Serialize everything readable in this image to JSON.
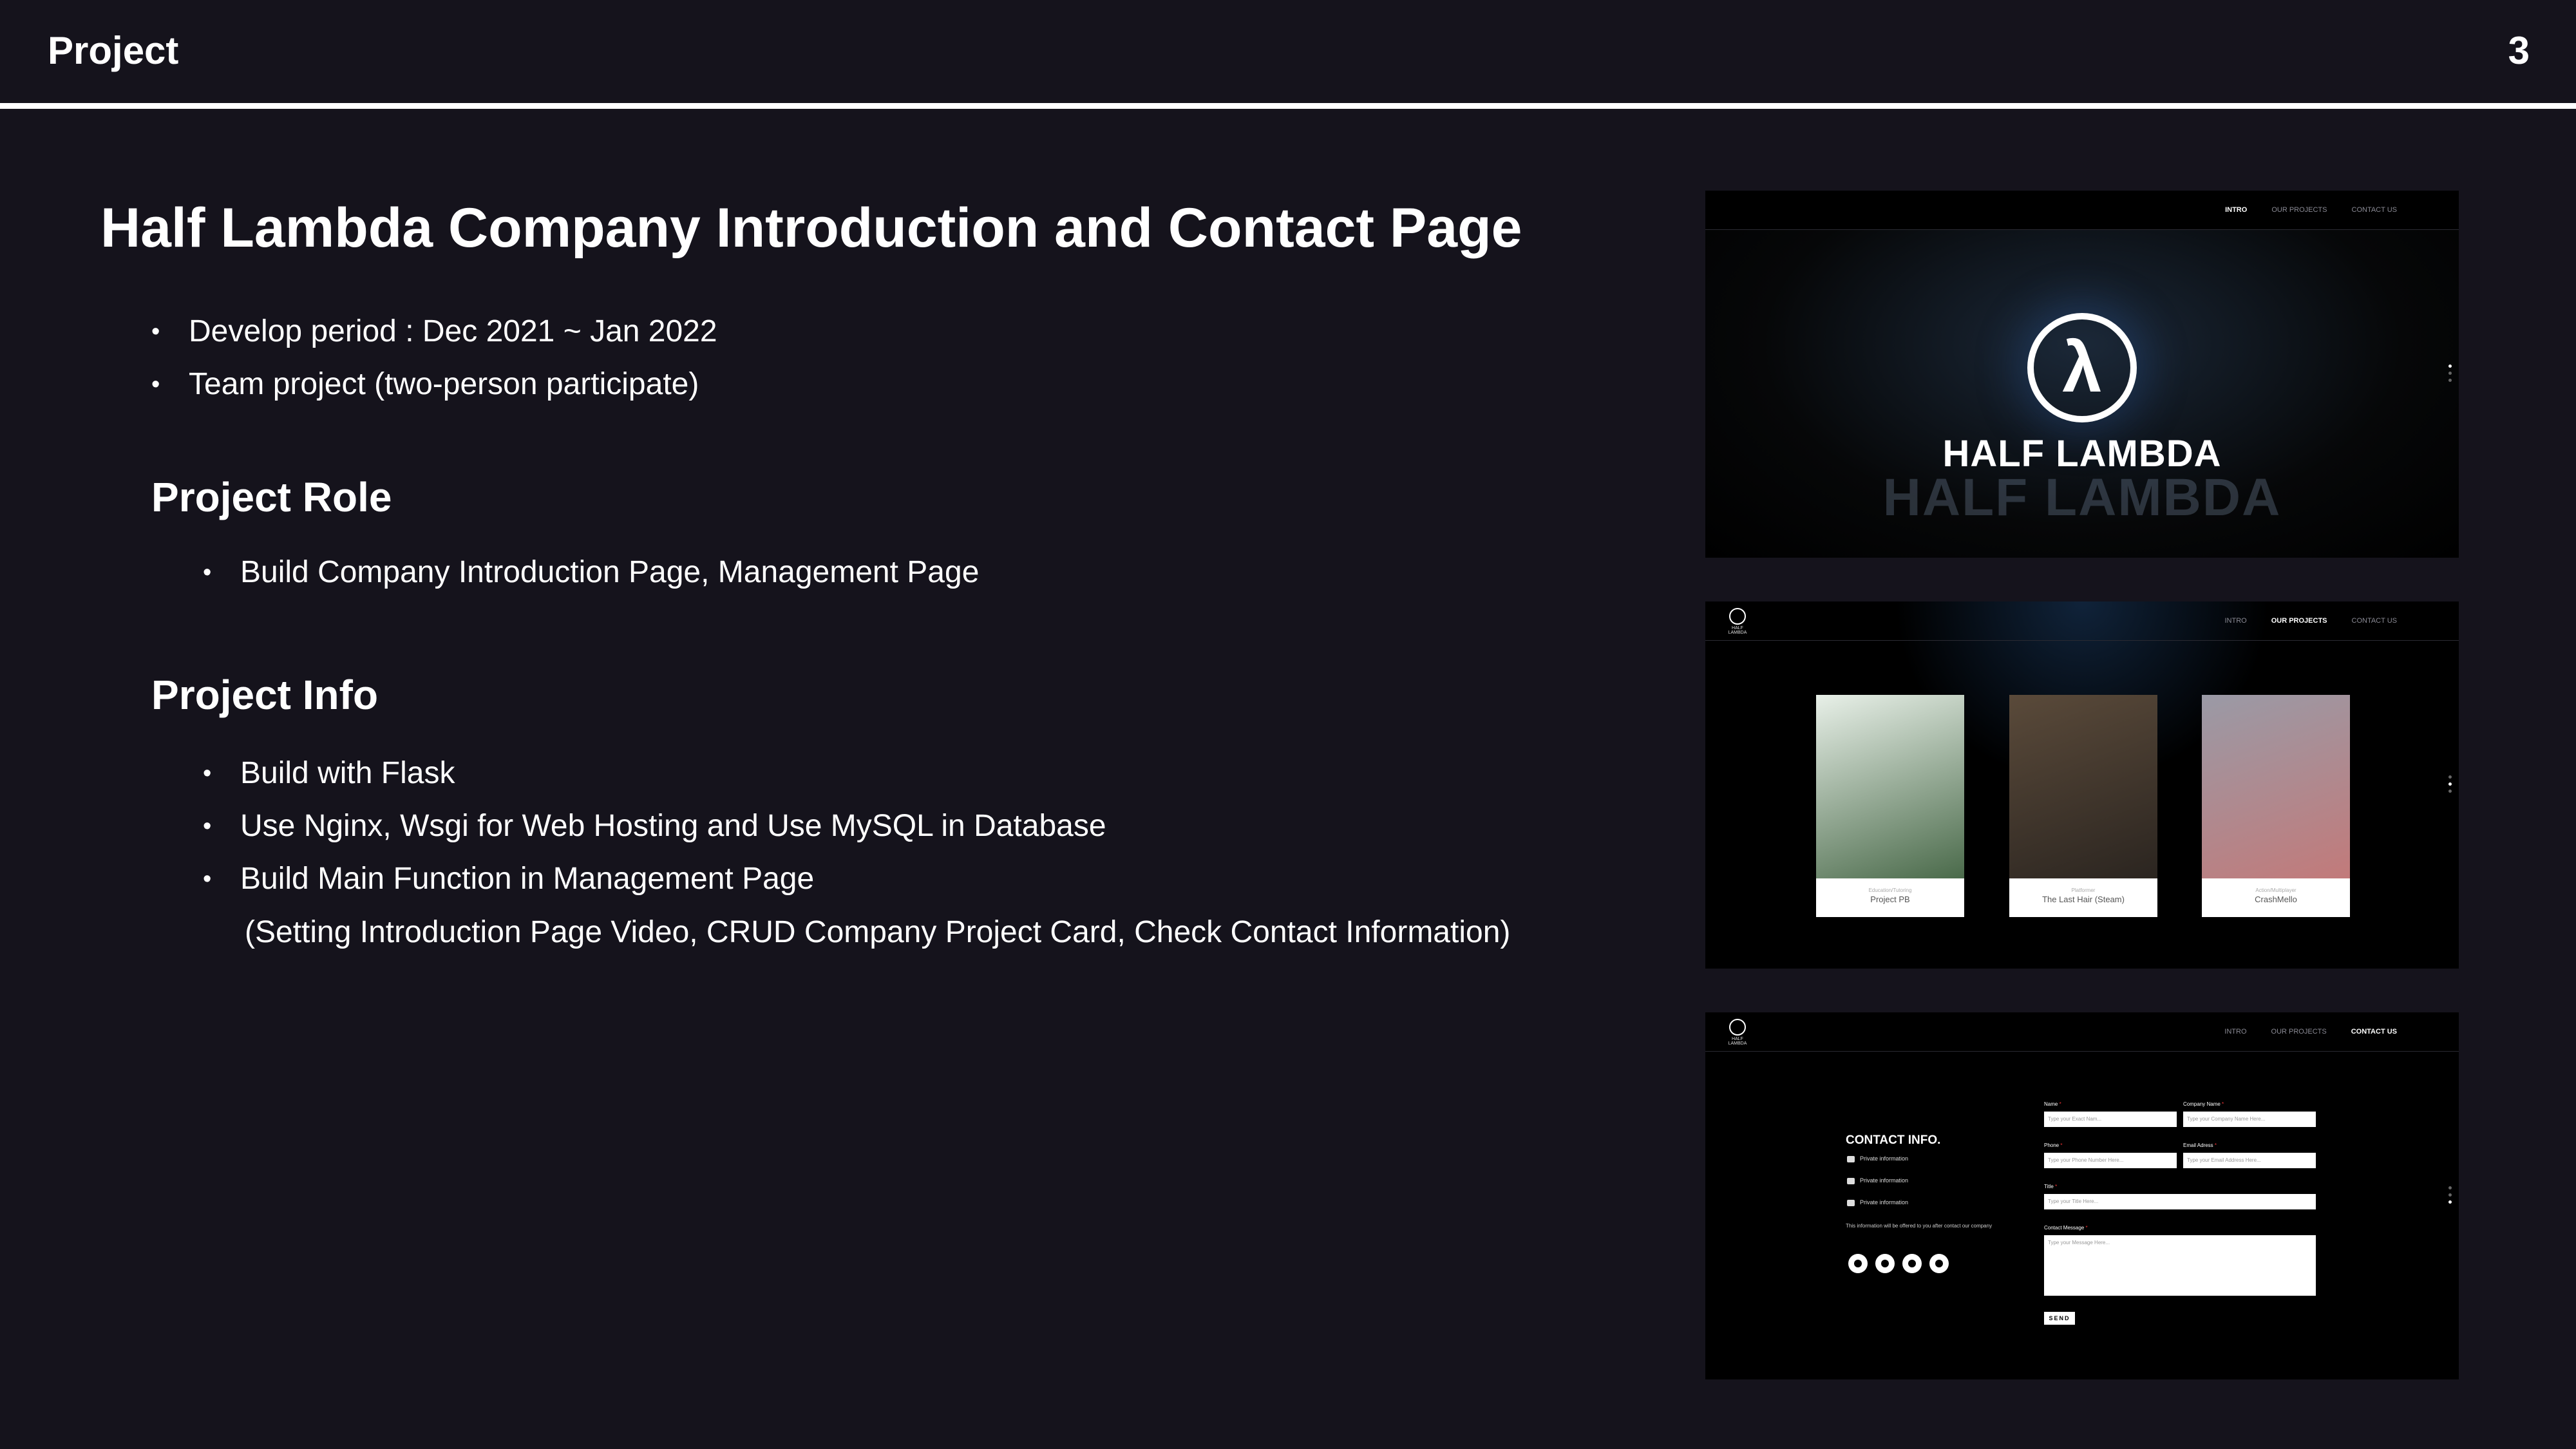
{
  "header": {
    "title": "Project",
    "page_number": "3"
  },
  "main": {
    "title": "Half Lambda Company Introduction and Contact Page",
    "intro_bullets": [
      "Develop period : Dec 2021 ~ Jan 2022",
      "Team project (two-person participate)"
    ],
    "role": {
      "heading": "Project Role",
      "bullets": [
        "Build Company Introduction Page, Management Page"
      ]
    },
    "info": {
      "heading": "Project Info",
      "bullets": [
        "Build with Flask",
        "Use Nginx, Wsgi for Web Hosting and Use MySQL in Database",
        "Build Main Function in Management Page"
      ],
      "continuation": "(Setting Introduction Page Video, CRUD Company Project Card, Check Contact Information)"
    }
  },
  "screenshots": {
    "nav": [
      "INTRO",
      "OUR PROJECTS",
      "CONTACT US"
    ],
    "logo_text": "HALF LAMBDA",
    "intro": {
      "brand": "HALF LAMBDA",
      "brand_reflection": "HALF LAMBDA"
    },
    "projects": {
      "cards": [
        {
          "category": "Education/Tutoring",
          "name": "Project PB",
          "color_top": "#e8f0e8",
          "color_bottom": "#4a6a4a"
        },
        {
          "category": "Platformer",
          "name": "The Last Hair (Steam)",
          "color_top": "#5a4a3a",
          "color_bottom": "#2b2520"
        },
        {
          "category": "Action/Multiplayer",
          "name": "CrashMello",
          "color_top": "#9a9aa6",
          "color_bottom": "#c27a7a"
        }
      ]
    },
    "contact": {
      "heading": "CONTACT INFO.",
      "rows": [
        "Private information",
        "Private information",
        "Private information"
      ],
      "note": "This information will be offered to you after contact our company",
      "fields": {
        "name_label": "Name",
        "name_placeholder": "Type your Exact Nam...",
        "company_label": "Company Name",
        "company_placeholder": "Type your Company Name Here...",
        "phone_label": "Phone",
        "phone_placeholder": "Type your Phone Number Here...",
        "email_label": "Email Adress",
        "email_placeholder": "Type your Email Address Here...",
        "title_label": "Title",
        "title_placeholder": "Type your Title Here...",
        "message_label": "Contact Message",
        "message_placeholder": "Type your Message Here...",
        "required_mark": "*"
      },
      "send_label": "SEND"
    }
  }
}
